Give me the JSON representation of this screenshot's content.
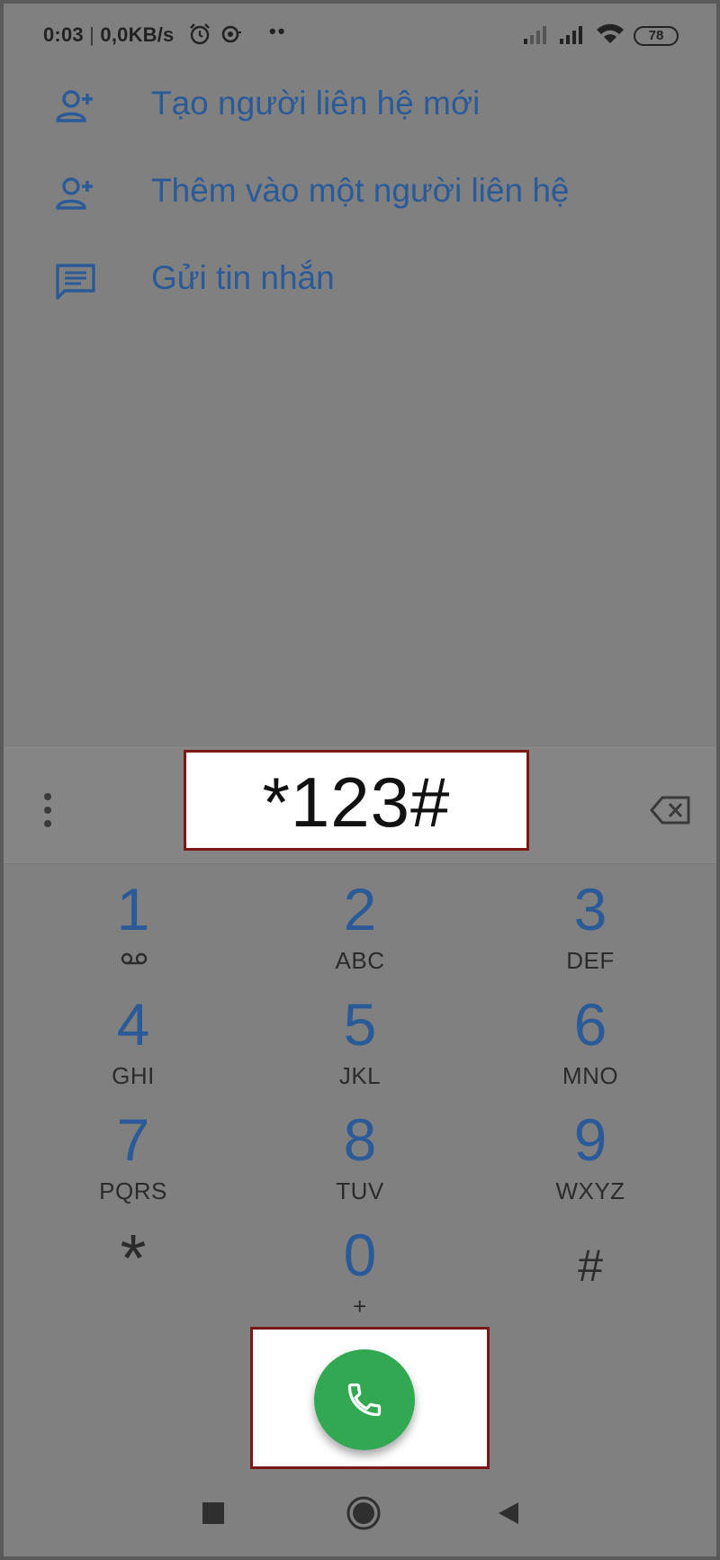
{
  "status_bar": {
    "time": "0:03",
    "separator": "|",
    "net_speed": "0,0KB/s",
    "dots": "••",
    "battery": "78"
  },
  "actions": [
    {
      "label": "Tạo người liên hệ mới",
      "icon": "person-add-icon"
    },
    {
      "label": "Thêm vào một người liên hệ",
      "icon": "person-add-icon"
    },
    {
      "label": "Gửi tin nhắn",
      "icon": "message-icon"
    }
  ],
  "dial": {
    "number": "*123#"
  },
  "keypad": {
    "keys": [
      {
        "digit": "1",
        "letters": ""
      },
      {
        "digit": "2",
        "letters": "ABC"
      },
      {
        "digit": "3",
        "letters": "DEF"
      },
      {
        "digit": "4",
        "letters": "GHI"
      },
      {
        "digit": "5",
        "letters": "JKL"
      },
      {
        "digit": "6",
        "letters": "MNO"
      },
      {
        "digit": "7",
        "letters": "PQRS"
      },
      {
        "digit": "8",
        "letters": "TUV"
      },
      {
        "digit": "9",
        "letters": "WXYZ"
      },
      {
        "digit": "*",
        "letters": ""
      },
      {
        "digit": "0",
        "letters": "+"
      },
      {
        "digit": "#",
        "letters": ""
      }
    ]
  },
  "colors": {
    "accent_text": "#2a5a98",
    "call_button": "#33a853",
    "highlight_border": "#7a1818"
  }
}
